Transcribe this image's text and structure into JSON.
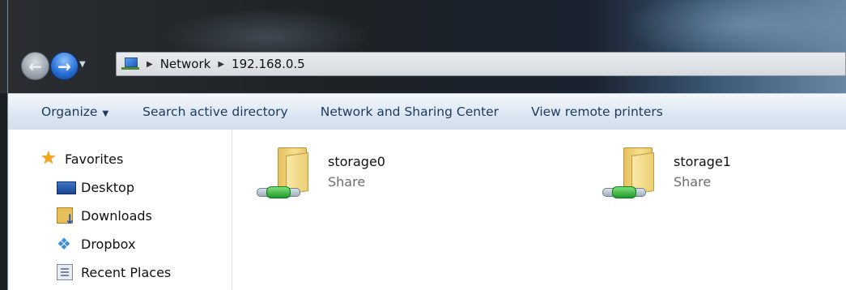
{
  "address": {
    "crumbs": [
      "Network",
      "192.168.0.5"
    ]
  },
  "toolbar": {
    "organize": "Organize",
    "search_ad": "Search active directory",
    "network_sharing": "Network and Sharing Center",
    "remote_printers": "View remote printers"
  },
  "sidebar": {
    "items": [
      {
        "label": "Favorites",
        "icon": "star-icon"
      },
      {
        "label": "Desktop",
        "icon": "desktop-icon"
      },
      {
        "label": "Downloads",
        "icon": "downloads-icon"
      },
      {
        "label": "Dropbox",
        "icon": "dropbox-icon"
      },
      {
        "label": "Recent Places",
        "icon": "recent-places-icon"
      }
    ]
  },
  "shares": [
    {
      "name": "storage0",
      "type": "Share"
    },
    {
      "name": "storage1",
      "type": "Share"
    }
  ]
}
